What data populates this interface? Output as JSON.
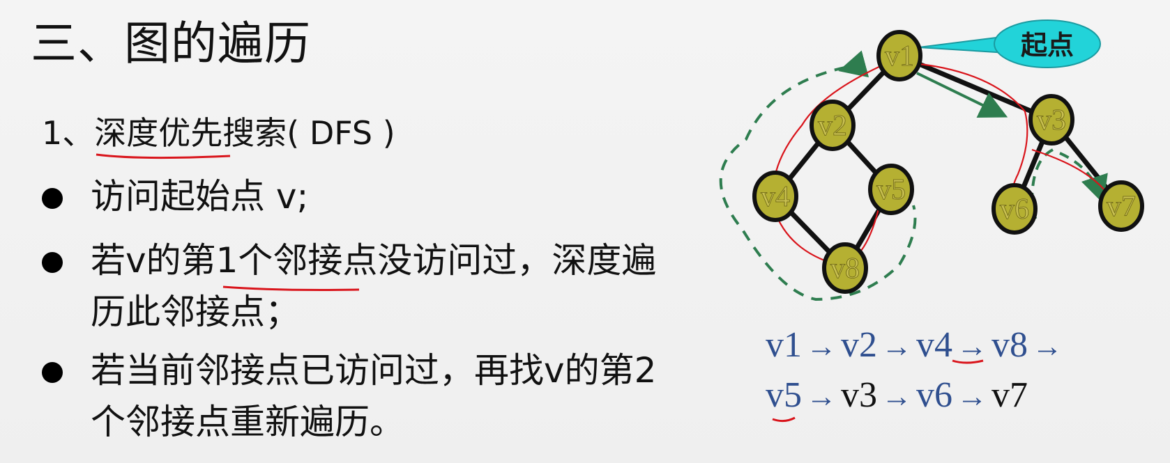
{
  "slide": {
    "title": "三、图的遍历",
    "subtitle_prefix": "1、",
    "subtitle_main": "深度优先搜索",
    "subtitle_suffix": "( DFS )",
    "bullets": [
      "访问起始点 v;",
      "若v的第1个邻接点没访问过，深度遍\n历此邻接点；",
      "若当前邻接点已访问过，再找v的第2\n个邻接点重新遍历。"
    ]
  },
  "graph": {
    "callout": "起点",
    "nodes": [
      {
        "id": "v1",
        "label": "v1"
      },
      {
        "id": "v2",
        "label": "v2"
      },
      {
        "id": "v3",
        "label": "v3"
      },
      {
        "id": "v4",
        "label": "v4"
      },
      {
        "id": "v5",
        "label": "v5"
      },
      {
        "id": "v6",
        "label": "v6"
      },
      {
        "id": "v7",
        "label": "v7"
      },
      {
        "id": "v8",
        "label": "v8"
      }
    ],
    "edges": [
      [
        "v1",
        "v2"
      ],
      [
        "v1",
        "v3"
      ],
      [
        "v2",
        "v4"
      ],
      [
        "v2",
        "v5"
      ],
      [
        "v4",
        "v8"
      ],
      [
        "v5",
        "v8"
      ],
      [
        "v3",
        "v6"
      ],
      [
        "v3",
        "v7"
      ]
    ],
    "node_fill": "#b5b032",
    "node_label_color": "#c8c050",
    "callout_fill": "#22d3d9"
  },
  "sequence": {
    "row1": [
      "v1",
      "v2",
      "v4",
      "v8"
    ],
    "row2": [
      "v5",
      "v3",
      "v6",
      "v7"
    ],
    "arrow": "→"
  }
}
